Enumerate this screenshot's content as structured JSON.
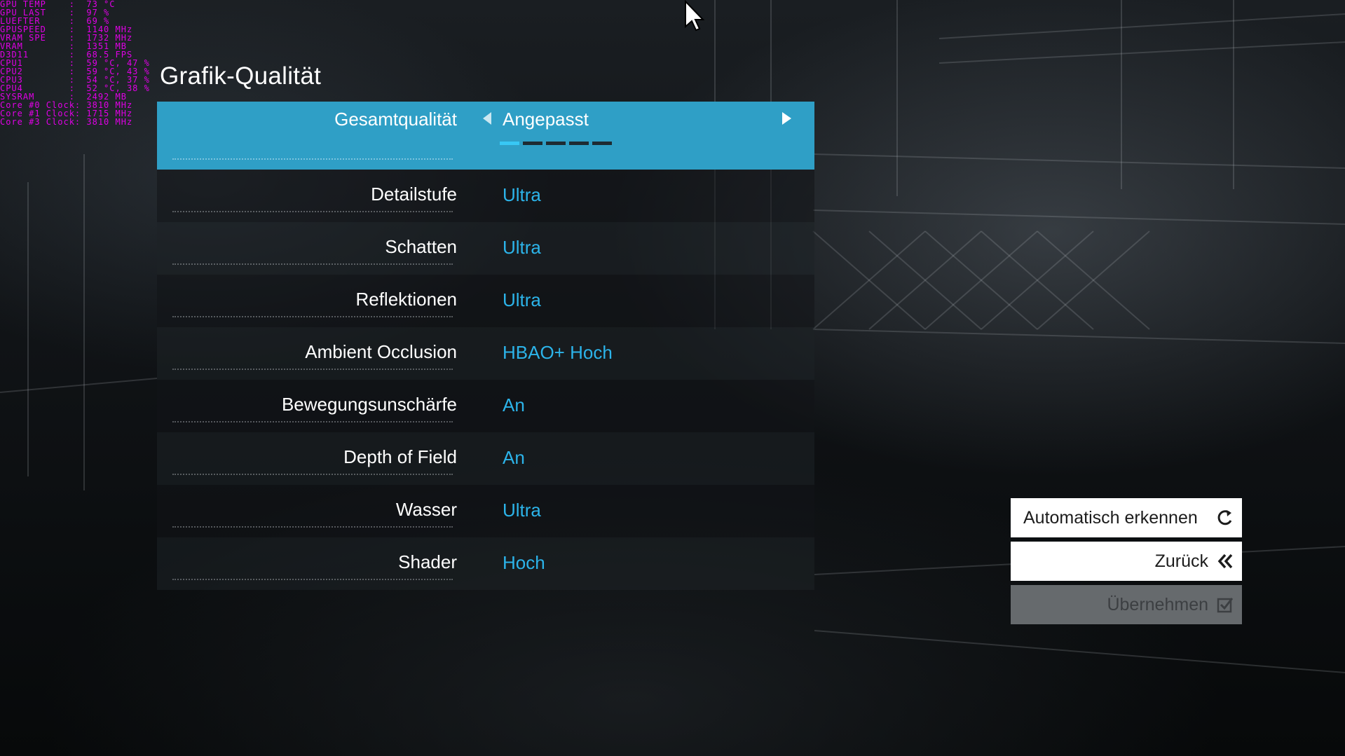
{
  "hud_overlay": [
    "GPU TEMP    :  73 °C",
    "GPU LAST    :  97 %",
    "LUEFTER     :  69 %",
    "GPUSPEED    :  1140 MHz",
    "VRAM SPE    :  1732 MHz",
    "VRAM        :  1351 MB",
    "D3D11       :  68.5 FPS",
    "CPU1        :  59 °C, 47 %",
    "CPU2        :  59 °C, 43 %",
    "CPU3        :  54 °C, 37 %",
    "CPU4        :  52 °C, 38 %",
    "SYSRAM      :  2492 MB",
    "Core #0 Clock: 3810 MHz",
    "Core #1 Clock: 1715 MHz",
    "Core #3 Clock: 3810 MHz"
  ],
  "title": "Grafik-Qualität",
  "overall": {
    "label": "Gesamtqualität",
    "value": "Angepasst",
    "preset_count": 5,
    "active_preset_index": 0
  },
  "settings": [
    {
      "label": "Detailstufe",
      "value": "Ultra"
    },
    {
      "label": "Schatten",
      "value": "Ultra"
    },
    {
      "label": "Reflektionen",
      "value": "Ultra"
    },
    {
      "label": "Ambient Occlusion",
      "value": "HBAO+ Hoch"
    },
    {
      "label": "Bewegungsunschärfe",
      "value": "An"
    },
    {
      "label": "Depth of Field",
      "value": "An"
    },
    {
      "label": "Wasser",
      "value": "Ultra"
    },
    {
      "label": "Shader",
      "value": "Hoch"
    }
  ],
  "buttons": {
    "auto_detect": {
      "label": "Automatisch erkennen",
      "icon": "refresh-icon"
    },
    "back": {
      "label": "Zurück",
      "icon": "double-chevron-left-icon"
    },
    "apply": {
      "label": "Übernehmen",
      "icon": "checkbox-icon",
      "enabled": false
    }
  },
  "colors": {
    "accent": "#2f9fc6",
    "value_text": "#2cb4ea",
    "overlay_text": "#e000e6"
  }
}
